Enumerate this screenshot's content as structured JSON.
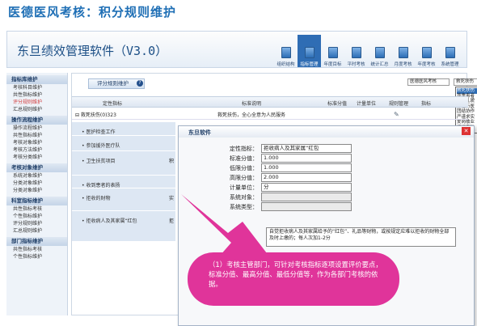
{
  "page_title": "医德医风考核：积分规则维护",
  "app": {
    "name": "东旦绩效管理软件（V3.0）"
  },
  "nav": [
    {
      "label": "组织结构",
      "on": false
    },
    {
      "label": "指标管理",
      "on": true
    },
    {
      "label": "年度目标",
      "on": false
    },
    {
      "label": "平时考核",
      "on": false
    },
    {
      "label": "统计汇总",
      "on": false
    },
    {
      "label": "月度考核",
      "on": false
    },
    {
      "label": "年度考核",
      "on": false
    },
    {
      "label": "系统管理",
      "on": false
    }
  ],
  "sidebar": [
    {
      "group": "指标库维护",
      "items": [
        {
          "t": "考核科目维护",
          "hl": false
        },
        {
          "t": "共性指标维护",
          "hl": false
        },
        {
          "t": "评分规则维护",
          "hl": true
        },
        {
          "t": "汇总规则维护",
          "hl": false
        }
      ]
    },
    {
      "group": "操作流程维护",
      "items": [
        {
          "t": "操作流程维护",
          "hl": false
        },
        {
          "t": "共性指标维护",
          "hl": false
        },
        {
          "t": "考核对象维护",
          "hl": false
        },
        {
          "t": "考核方法维护",
          "hl": false
        },
        {
          "t": "考核分类维护",
          "hl": false
        }
      ]
    },
    {
      "group": "考核对象维护",
      "items": [
        {
          "t": "系统对象维护",
          "hl": false
        },
        {
          "t": "分类对象维护",
          "hl": false
        },
        {
          "t": "分类对象维护",
          "hl": false
        }
      ]
    },
    {
      "group": "科室指标维护",
      "items": [
        {
          "t": "共性指标考核",
          "hl": false
        },
        {
          "t": "个性指标维护",
          "hl": false
        },
        {
          "t": "评分规则维护",
          "hl": false
        },
        {
          "t": "汇总规则维护",
          "hl": false
        }
      ]
    },
    {
      "group": "部门指标维护",
      "items": [
        {
          "t": "共性指标考核",
          "hl": false
        },
        {
          "t": "个性指标维护",
          "hl": false
        }
      ]
    }
  ],
  "main": {
    "tab": "评分规则维护",
    "tab_info": "?",
    "select1": "医德医风考核",
    "select2": "救死扶伤",
    "dropdown": [
      "救死扶伤",
      "尊重患者",
      "文明礼貌",
      "廉洁行医",
      "团结协作",
      "严谨求实",
      "爱岗敬业",
      "遵纪守法"
    ],
    "headers": [
      "定性指标",
      "标准说明",
      "标准分值",
      "计量单位",
      "规则管理",
      "指标"
    ],
    "row0": {
      "c1": "⊟ 救死扶伤(0)323",
      "c2": "救死扶伤，全心全意为人民服务"
    },
    "indicators": [
      "• 医护检查工作",
      "• 参加援外医疗队",
      "• 卫生扶贫项目",
      "• 收到患者的表扬",
      "• 拒收的财物",
      "• 拒收病人及其家属“红包"
    ],
    "ind_tail": [
      "",
      "",
      "积",
      "",
      "实",
      "拒"
    ]
  },
  "dialog": {
    "title": "东旦软件",
    "fields": [
      {
        "label": "定性指标：",
        "value": "拒收病人及其家属“红包",
        "gray": false
      },
      {
        "label": "标准分值：",
        "value": "1.000",
        "gray": false
      },
      {
        "label": "低限分值：",
        "value": "1.000",
        "gray": false
      },
      {
        "label": "高限分值：",
        "value": "2.000",
        "gray": false
      },
      {
        "label": "计量单位：",
        "value": "分",
        "gray": false
      },
      {
        "label": "系统对象：",
        "value": "",
        "gray": true
      },
      {
        "label": "系统类型：",
        "value": "",
        "gray": true
      }
    ],
    "description": "自觉拒收病人及其家属给予的“红包”、礼品等财物，或按规定应难以拒收的财物全部及时上缴的；每人次加1-2分"
  },
  "callout": "（1）考核主管部门，可针对考核指标逐项设置评价要点，标准分值、最高分值、最低分值等，作为各部门考核的依据。",
  "colors": {
    "accent": "#2f6db4",
    "callout": "#e0349a",
    "highlight": "#d23c3c"
  }
}
